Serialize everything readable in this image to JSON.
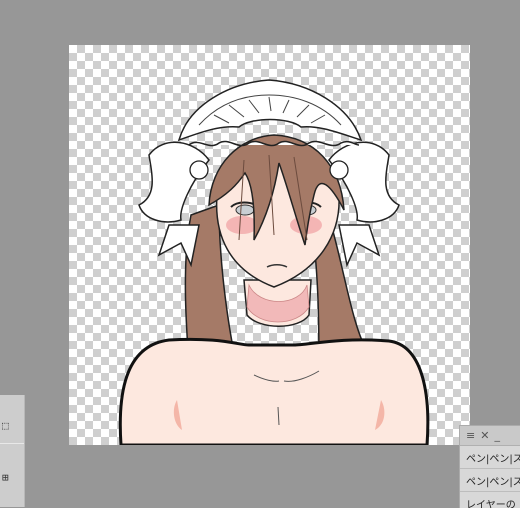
{
  "canvas": {
    "artwork": "illustration-of-character-with-maid-headdress",
    "transparency_grid": "checkerboard"
  },
  "left_panel": {
    "icons": [
      "selection-rect-icon",
      "layer-icon"
    ]
  },
  "right_panel": {
    "icons": {
      "menu": "≡",
      "close": "✕",
      "minimize": "_"
    },
    "rows": [
      {
        "label": "ペン|ペン|ス"
      },
      {
        "label": "ペン|ペン|ス"
      },
      {
        "label": "レイヤーの"
      }
    ]
  },
  "colors": {
    "workspace": "#979797",
    "hair": "#a57a67",
    "skin": "#fde8df",
    "blush": "#f0a4a6",
    "frill": "#ffffff"
  }
}
